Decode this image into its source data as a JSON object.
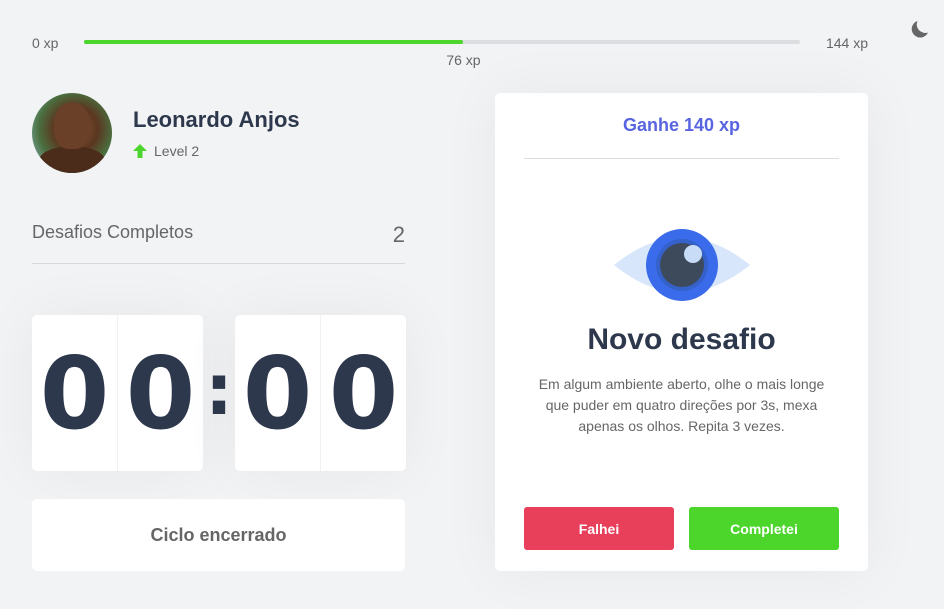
{
  "xp": {
    "min_label": "0 xp",
    "max_label": "144 xp",
    "current_label": "76 xp",
    "progress_fraction": 0.53
  },
  "profile": {
    "name": "Leonardo Anjos",
    "level_label": "Level 2"
  },
  "completed": {
    "label": "Desafios Completos",
    "count": "2"
  },
  "countdown": {
    "minute_left": "0",
    "minute_right": "0",
    "colon": ":",
    "second_left": "0",
    "second_right": "0"
  },
  "cycle_button": {
    "label": "Ciclo encerrado"
  },
  "challenge": {
    "header": "Ganhe 140 xp",
    "title": "Novo desafio",
    "description": "Em algum ambiente aberto, olhe o mais longe que puder em quatro direções por 3s, mexa apenas os olhos. Repita 3 vezes.",
    "fail_label": "Falhei",
    "success_label": "Completei"
  },
  "icons": {
    "theme_toggle": "moon-icon",
    "level": "arrow-up-icon",
    "challenge_type": "eye-icon"
  },
  "colors": {
    "accent": "#5965e0",
    "success": "#4cd62b",
    "fail": "#e83f5b",
    "text": "#2e384d"
  }
}
